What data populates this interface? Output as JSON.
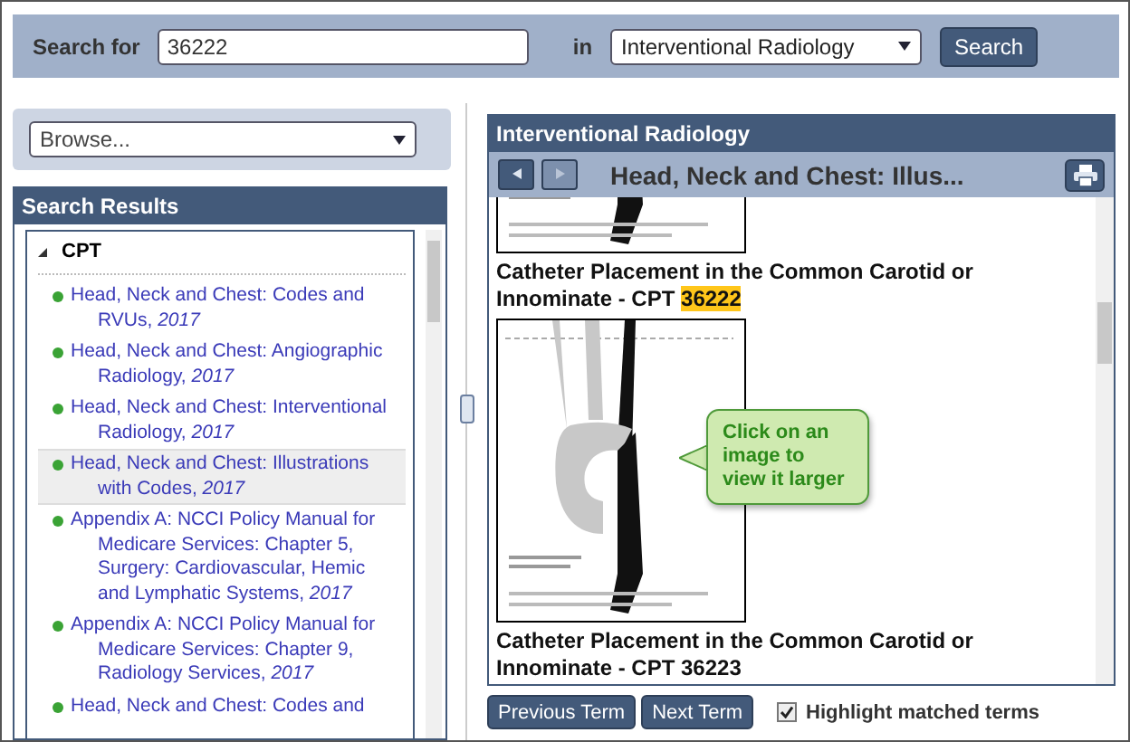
{
  "search": {
    "label": "Search for",
    "value": "36222",
    "in_label": "in",
    "scope": "Interventional Radiology",
    "button": "Search"
  },
  "browse": {
    "placeholder": "Browse..."
  },
  "results": {
    "title": "Search Results",
    "tree": [
      {
        "label": "CPT",
        "expanded": true,
        "children": [
          {
            "label": "Head, Neck and Chest: Codes and RVUs, *2017*",
            "selected": false
          },
          {
            "label": "Head, Neck and Chest: Angiographic Radiology, *2017*",
            "selected": false
          },
          {
            "label": "Head, Neck and Chest: Interventional Radiology, *2017*",
            "selected": false
          },
          {
            "label": "Head, Neck and Chest: Illustrations with Codes, *2017*",
            "selected": true
          },
          {
            "label": "Appendix A: NCCI Policy Manual for Medicare Services: Chapter 5, Surgery: Cardiovascular, Hemic and Lymphatic Systems, *2017*",
            "selected": false
          },
          {
            "label": "Appendix A: NCCI Policy Manual for Medicare Services: Chapter 9, Radiology Services, *2017*",
            "selected": false
          },
          {
            "label": "Head, Neck and Chest: Codes and",
            "selected": false
          }
        ]
      }
    ]
  },
  "viewer": {
    "title": "Interventional Radiology",
    "nav": [
      {
        "disabled": false
      },
      {
        "disabled": true
      }
    ],
    "document_title": "Head, Neck and Chest: Illus...",
    "content": [
      {
        "kind": "image",
        "partial": true
      },
      {
        "kind": "heading",
        "text": "Catheter Placement in the Common Carotid or Innominate - CPT",
        "match": "36222"
      },
      {
        "kind": "image",
        "partial": false
      },
      {
        "kind": "heading",
        "text": "Catheter Placement in the Common Carotid or Innominate - CPT 36223"
      }
    ],
    "tooltip": "Click on an image to view it larger"
  },
  "footer": {
    "buttons": [
      "Previous Term",
      "Next Term"
    ],
    "highlight": {
      "label": "Highlight matched terms",
      "checked": true
    }
  }
}
